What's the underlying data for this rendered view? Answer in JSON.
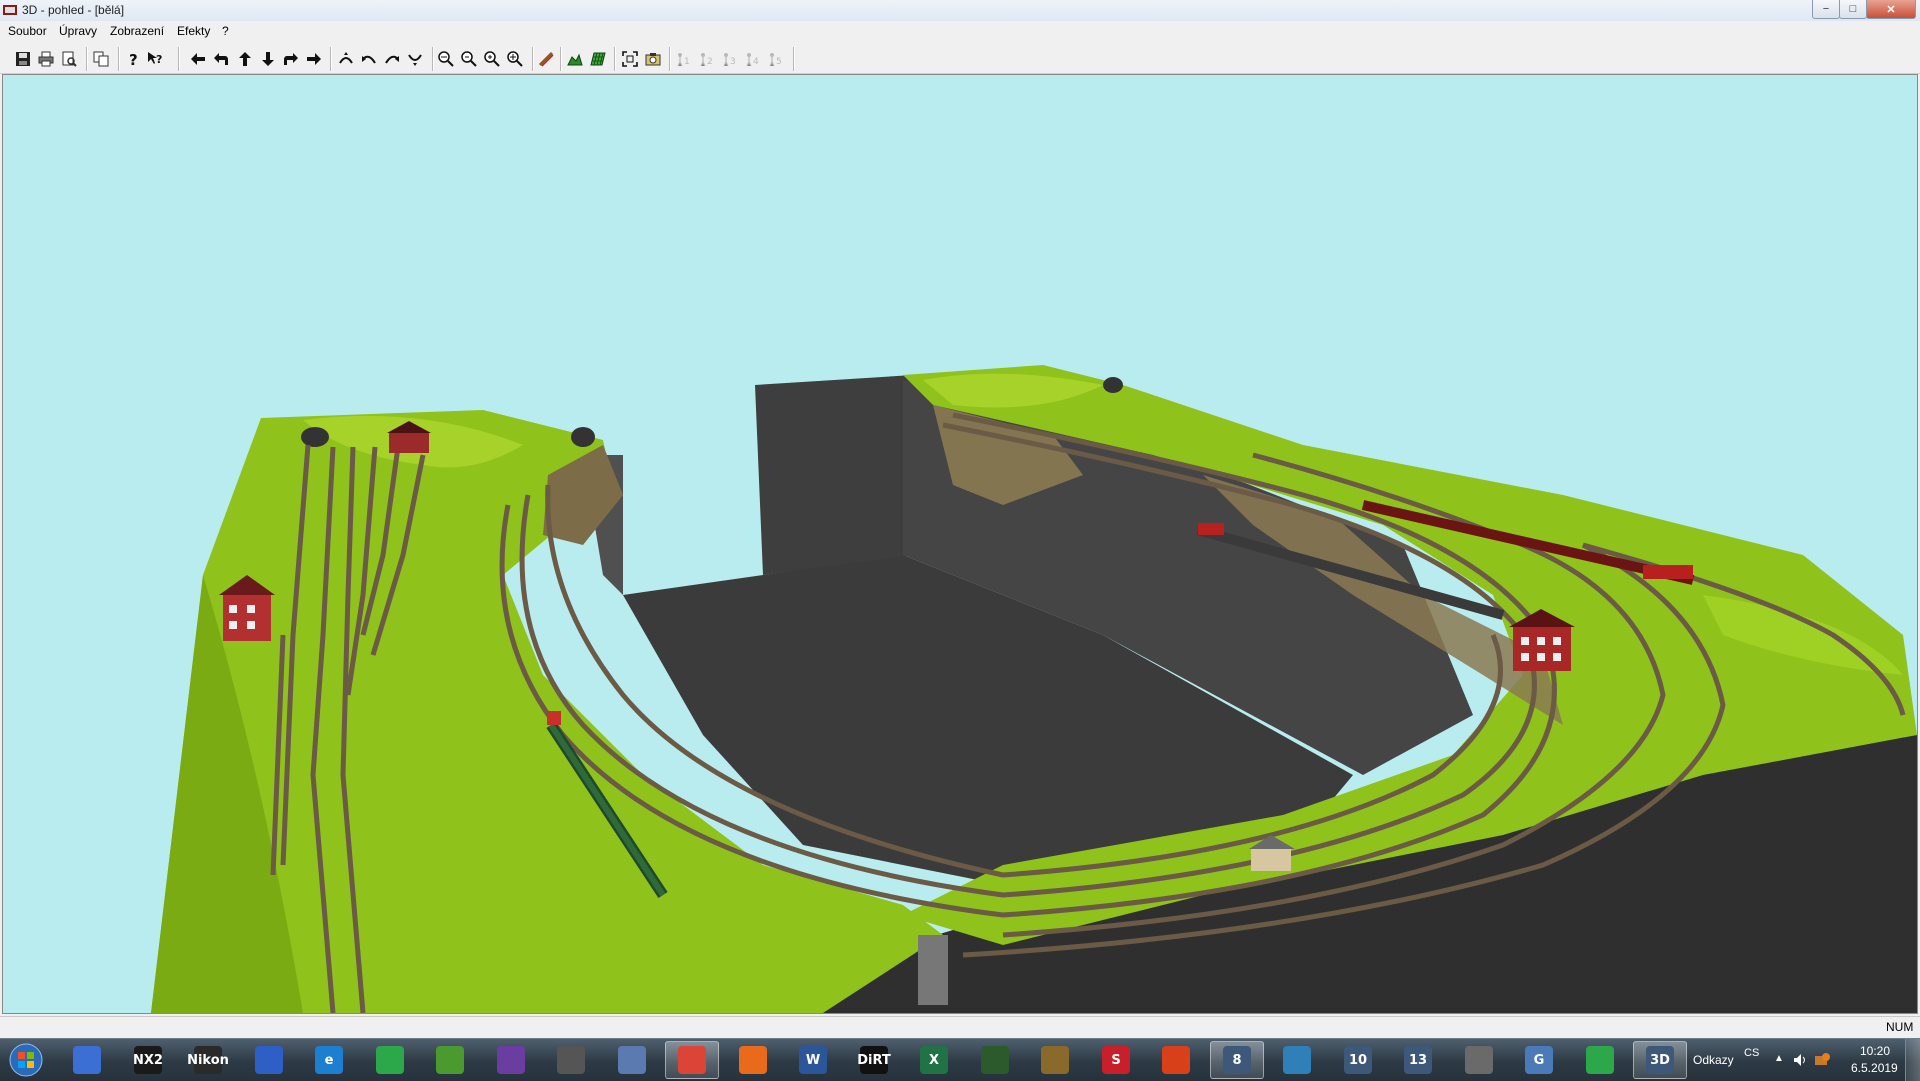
{
  "window": {
    "title": "3D - pohled - [bělá]",
    "controls": {
      "minimize": "−",
      "maximize": "□",
      "close": "✕"
    }
  },
  "menu": [
    "Soubor",
    "Úpravy",
    "Zobrazení",
    "Efekty",
    "?"
  ],
  "toolbar": {
    "buttons": [
      {
        "icon": "save-icon",
        "name": "save-button"
      },
      {
        "icon": "print-icon",
        "name": "print-button"
      },
      {
        "icon": "print-preview-icon",
        "name": "print-preview-button"
      },
      {
        "icon": "copy-icon",
        "name": "copy-button"
      },
      {
        "icon": "help-icon",
        "name": "help-button"
      },
      {
        "icon": "context-help-icon",
        "name": "context-help-button"
      },
      {
        "icon": "arrow-left-icon",
        "name": "move-left-button"
      },
      {
        "icon": "turn-left-icon",
        "name": "turn-left-button"
      },
      {
        "icon": "arrow-up-icon",
        "name": "move-forward-button"
      },
      {
        "icon": "arrow-down-icon",
        "name": "move-back-button"
      },
      {
        "icon": "turn-right-icon",
        "name": "turn-right-button"
      },
      {
        "icon": "arrow-right-icon",
        "name": "move-right-button"
      },
      {
        "icon": "rotate-up-icon",
        "name": "tilt-up-button"
      },
      {
        "icon": "rotate-left-icon",
        "name": "rotate-left-button"
      },
      {
        "icon": "rotate-right-icon",
        "name": "rotate-right-button"
      },
      {
        "icon": "rotate-down-icon",
        "name": "tilt-down-button"
      },
      {
        "icon": "zoom-out-icon",
        "name": "zoom-out-button"
      },
      {
        "icon": "zoom-minus-icon",
        "name": "zoom-minus-button"
      },
      {
        "icon": "zoom-plus-icon",
        "name": "zoom-plus-button"
      },
      {
        "icon": "zoom-in-icon",
        "name": "zoom-in-button"
      },
      {
        "icon": "track-icon",
        "name": "track-button"
      },
      {
        "icon": "terrain-icon",
        "name": "terrain-button"
      },
      {
        "icon": "grid-icon",
        "name": "grid-button"
      },
      {
        "icon": "fit-view-icon",
        "name": "fit-view-button"
      },
      {
        "icon": "camera-icon",
        "name": "camera-button"
      }
    ],
    "viewpoints": [
      "1",
      "2",
      "3",
      "4",
      "5"
    ]
  },
  "status": {
    "indicator": "NUM"
  },
  "taskbar": {
    "apps": [
      {
        "name": "app-network",
        "label": "",
        "color": "#3b6fd4"
      },
      {
        "name": "app-nx2",
        "label": "NX2",
        "color": "#1a1a1a"
      },
      {
        "name": "app-nikon",
        "label": "Nikon",
        "color": "#2a2a2a"
      },
      {
        "name": "app-save",
        "label": "",
        "color": "#2d5fc4"
      },
      {
        "name": "app-internet-explorer",
        "label": "e",
        "color": "#1d7fd0"
      },
      {
        "name": "app-screen",
        "label": "",
        "color": "#2ca84a"
      },
      {
        "name": "app-media",
        "label": "",
        "color": "#4a9a2f"
      },
      {
        "name": "app-visual-studio",
        "label": "",
        "color": "#6a3ea1"
      },
      {
        "name": "app-helmet",
        "label": "",
        "color": "#555555"
      },
      {
        "name": "app-games",
        "label": "",
        "color": "#5a7ab0"
      },
      {
        "name": "app-chrome",
        "label": "",
        "color": "#db4437"
      },
      {
        "name": "app-firefox",
        "label": "",
        "color": "#e86a1a"
      },
      {
        "name": "app-word",
        "label": "W",
        "color": "#2b579a"
      },
      {
        "name": "app-dirt",
        "label": "DiRT",
        "color": "#111111"
      },
      {
        "name": "app-excel",
        "label": "X",
        "color": "#217346"
      },
      {
        "name": "app-railway",
        "label": "",
        "color": "#2c5a2c"
      },
      {
        "name": "app-color",
        "label": "",
        "color": "#8a6a2a"
      },
      {
        "name": "app-red-s",
        "label": "S",
        "color": "#c8202a"
      },
      {
        "name": "app-office",
        "label": "",
        "color": "#d8401a"
      },
      {
        "name": "app-rail-8",
        "label": "8",
        "color": "#3d5878"
      },
      {
        "name": "app-globe",
        "label": "",
        "color": "#2f7fb8"
      },
      {
        "name": "app-rail-10",
        "label": "10",
        "color": "#3d5878"
      },
      {
        "name": "app-rail-13",
        "label": "13",
        "color": "#3d5878"
      },
      {
        "name": "app-pickup",
        "label": "",
        "color": "#6a6a6a"
      },
      {
        "name": "app-g",
        "label": "G",
        "color": "#4a7ab8"
      },
      {
        "name": "app-screen-2",
        "label": "",
        "color": "#2ca84a"
      },
      {
        "name": "app-3d-view",
        "label": "3D",
        "color": "#3d5878"
      }
    ],
    "links": "Odkazy",
    "language": "CS",
    "time": "10:20",
    "date": "6.5.2019"
  }
}
